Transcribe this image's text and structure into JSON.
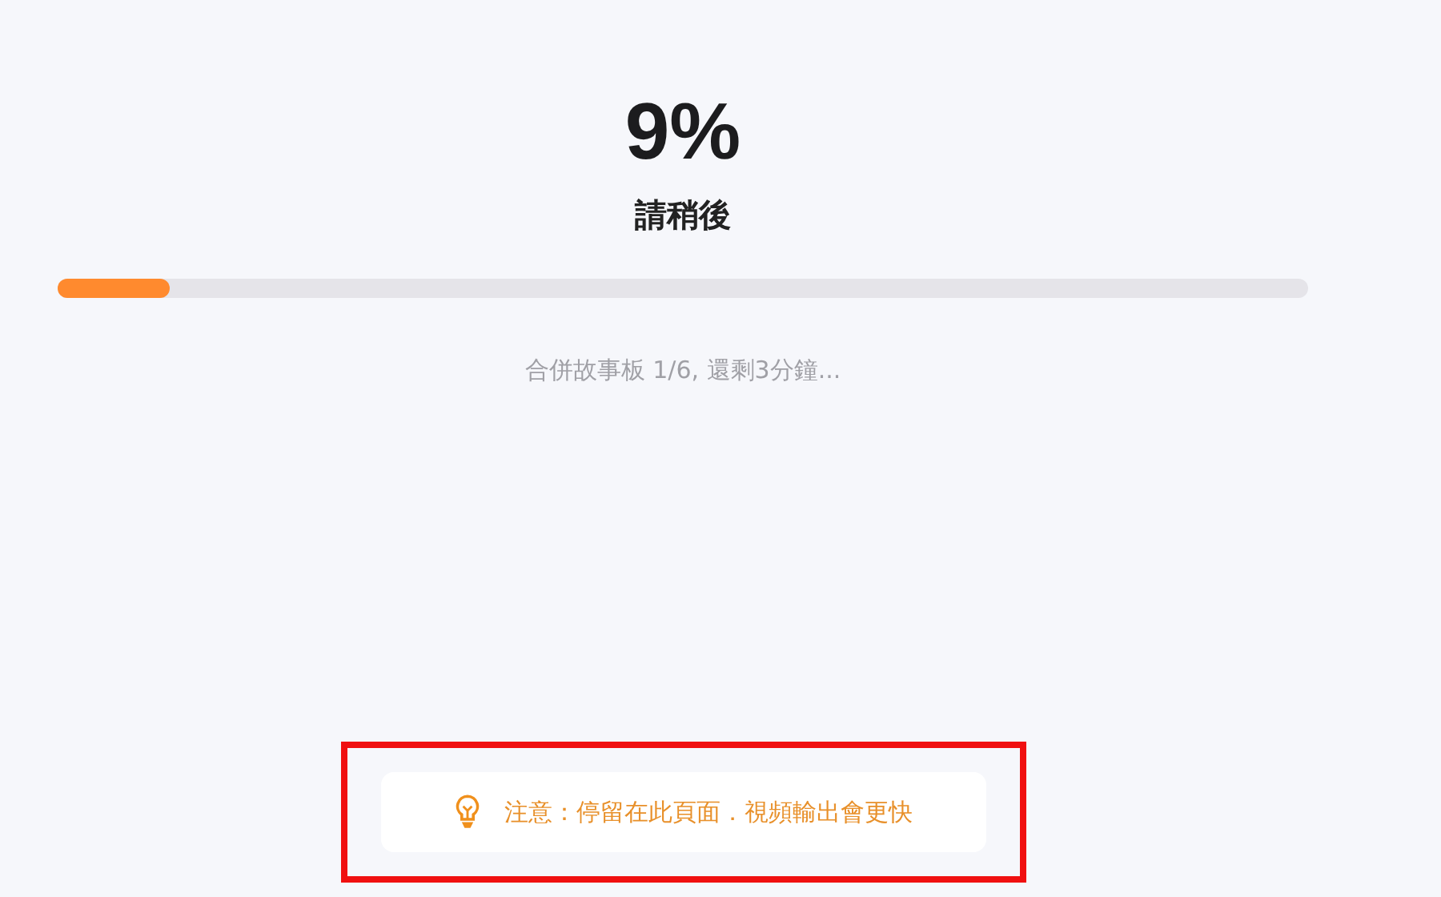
{
  "progress": {
    "percent": "9%",
    "title": "請稍後",
    "level": 0.09,
    "status": "合併故事板 1/6, 還剩3分鐘..."
  },
  "tip": {
    "text": "注意：停留在此頁面．視頻輸出會更快",
    "highlighted": true
  }
}
